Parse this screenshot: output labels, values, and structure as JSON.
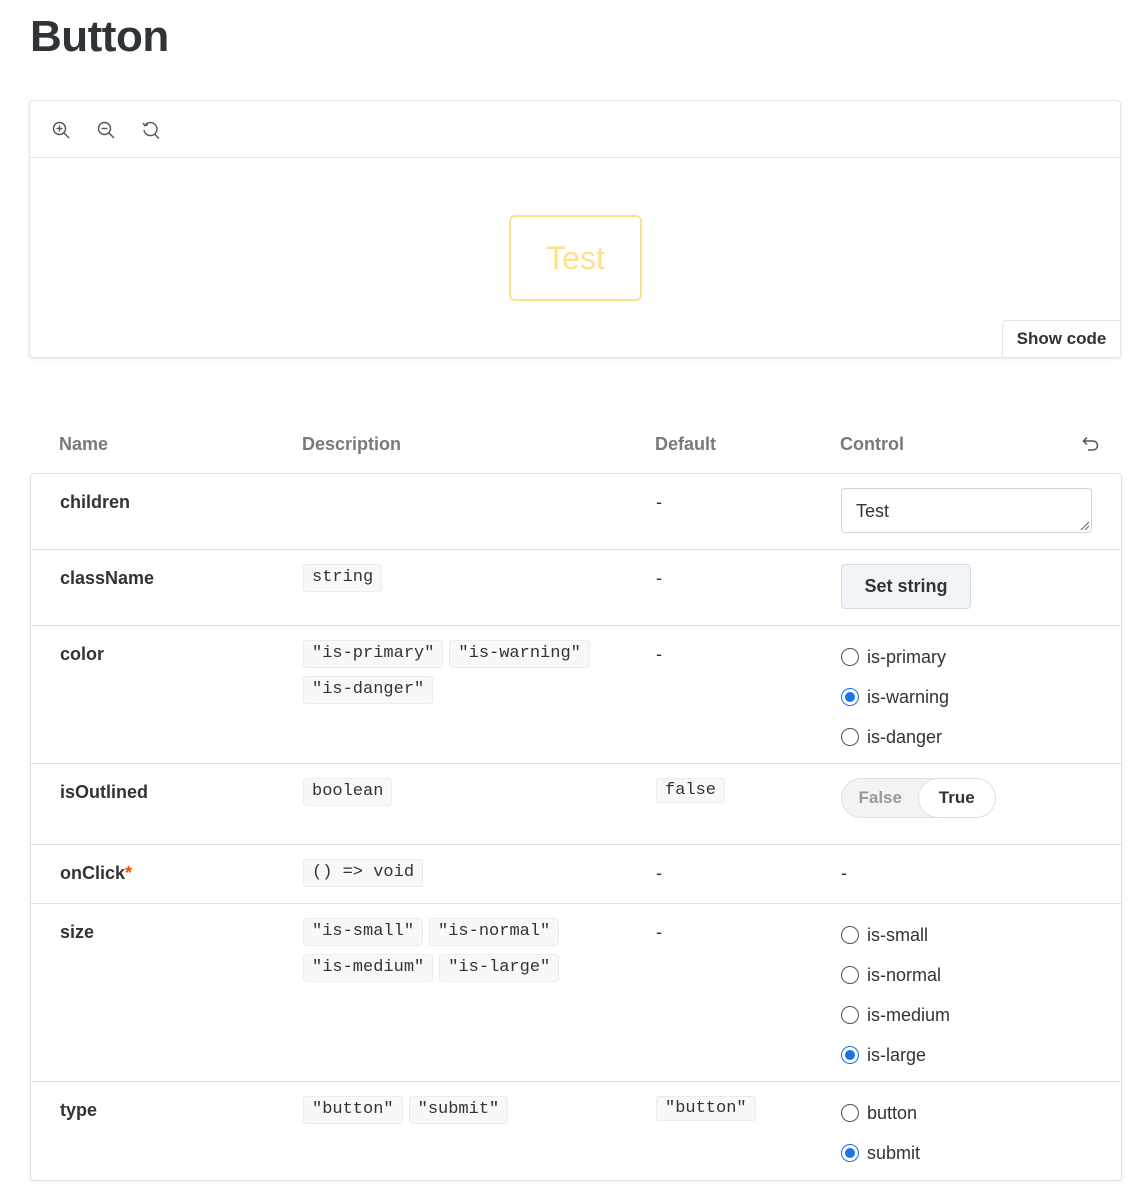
{
  "page": {
    "title": "Button"
  },
  "toolbar": {
    "zoom_in_icon": "zoom-in-icon",
    "zoom_out_icon": "zoom-out-icon",
    "reset_zoom_icon": "reset-zoom-icon"
  },
  "preview": {
    "button_label": "Test",
    "button_color": "#ffe08a",
    "show_code_label": "Show code"
  },
  "table": {
    "headers": {
      "name": "Name",
      "description": "Description",
      "default": "Default",
      "control": "Control"
    },
    "reset_icon": "undo-icon",
    "rows": {
      "children": {
        "name": "children",
        "default": "-",
        "control_value": "Test"
      },
      "className": {
        "name": "className",
        "types": [
          "string"
        ],
        "default": "-",
        "control_label": "Set string"
      },
      "color": {
        "name": "color",
        "types": [
          "\"is-primary\"",
          "\"is-warning\"",
          "\"is-danger\""
        ],
        "default": "-",
        "options": [
          "is-primary",
          "is-warning",
          "is-danger"
        ],
        "selected": "is-warning"
      },
      "isOutlined": {
        "name": "isOutlined",
        "types": [
          "boolean"
        ],
        "default": "false",
        "toggle_false": "False",
        "toggle_true": "True",
        "selected": "True"
      },
      "onClick": {
        "name": "onClick",
        "required_mark": "*",
        "types": [
          "() => void"
        ],
        "default": "-",
        "control": "-"
      },
      "size": {
        "name": "size",
        "types": [
          "\"is-small\"",
          "\"is-normal\"",
          "\"is-medium\"",
          "\"is-large\""
        ],
        "default": "-",
        "options": [
          "is-small",
          "is-normal",
          "is-medium",
          "is-large"
        ],
        "selected": "is-large"
      },
      "type": {
        "name": "type",
        "types": [
          "\"button\"",
          "\"submit\""
        ],
        "default": "\"button\"",
        "options": [
          "button",
          "submit"
        ],
        "selected": "submit"
      }
    }
  },
  "colors": {
    "accent": "#1a73e8",
    "required": "#ff4400",
    "warning": "#ffe08a"
  }
}
